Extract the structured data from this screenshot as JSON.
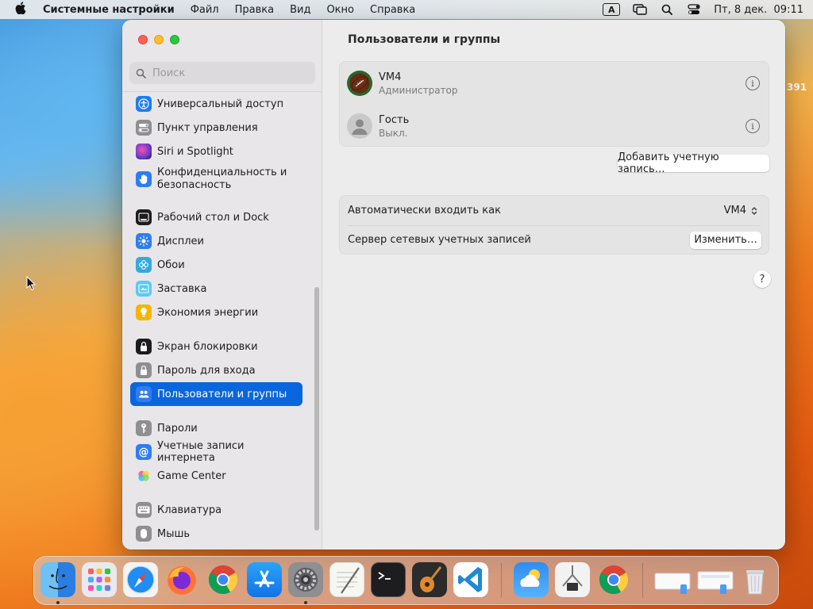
{
  "menubar": {
    "app_name": "Системные настройки",
    "menus": [
      "Файл",
      "Правка",
      "Вид",
      "Окно",
      "Справка"
    ],
    "input_badge": "A",
    "datetime": "Пт, 8 дек.  09:11"
  },
  "desktop": {
    "edge_label": "391"
  },
  "sidebar": {
    "search_placeholder": "Поиск",
    "items": [
      {
        "label": "Универсальный доступ",
        "icon": "accessibility-icon",
        "color": "#1e7cf2"
      },
      {
        "label": "Пункт управления",
        "icon": "control-center-icon",
        "color": "#8e8e93"
      },
      {
        "label": "Siri и Spotlight",
        "icon": "siri-icon",
        "color": "#6d3fd2"
      },
      {
        "label": "Конфиденциальность и безопасность",
        "icon": "privacy-hand-icon",
        "color": "#2f7cf6"
      },
      {
        "label": "Рабочий стол и Dock",
        "icon": "dock-icon",
        "color": "#1c1c1e"
      },
      {
        "label": "Дисплеи",
        "icon": "display-sun-icon",
        "color": "#2f7cf6"
      },
      {
        "label": "Обои",
        "icon": "wallpaper-icon",
        "color": "#34aadc"
      },
      {
        "label": "Заставка",
        "icon": "screensaver-icon",
        "color": "#5ac8fa"
      },
      {
        "label": "Экономия энергии",
        "icon": "battery-bulb-icon",
        "color": "#f7b500"
      },
      {
        "label": "Экран блокировки",
        "icon": "lock-screen-icon",
        "color": "#1c1c1e"
      },
      {
        "label": "Пароль для входа",
        "icon": "lock-icon",
        "color": "#8e8e93"
      },
      {
        "label": "Пользователи и группы",
        "icon": "users-icon",
        "color": "#2f7cf6",
        "active": true
      },
      {
        "label": "Пароли",
        "icon": "key-icon",
        "color": "#8e8e93"
      },
      {
        "label": "Учетные записи интернета",
        "icon": "at-sign-icon",
        "color": "#2f7cf6"
      },
      {
        "label": "Game Center",
        "icon": "game-center-icon",
        "color": "#ffffff"
      },
      {
        "label": "Клавиатура",
        "icon": "keyboard-icon",
        "color": "#8e8e93"
      },
      {
        "label": "Мышь",
        "icon": "mouse-icon",
        "color": "#8e8e93"
      }
    ]
  },
  "main": {
    "title": "Пользователи и группы",
    "users": [
      {
        "name": "VM4",
        "role": "Администратор"
      },
      {
        "name": "Гость",
        "role": "Выкл."
      }
    ],
    "add_account_label": "Добавить учетную запись…",
    "auto_login_label": "Автоматически входить как",
    "auto_login_value": "VM4",
    "network_server_label": "Сервер сетевых учетных записей",
    "change_label": "Изменить…",
    "help_label": "?"
  },
  "dock": {
    "apps": [
      "Finder",
      "Launchpad",
      "Safari",
      "Firefox",
      "Chrome",
      "App Store",
      "System Settings",
      "TextEdit",
      "Terminal",
      "GarageBand",
      "VS Code",
      "Weather",
      "Utility",
      "Chrome"
    ],
    "running": [
      "Finder",
      "System Settings"
    ]
  }
}
